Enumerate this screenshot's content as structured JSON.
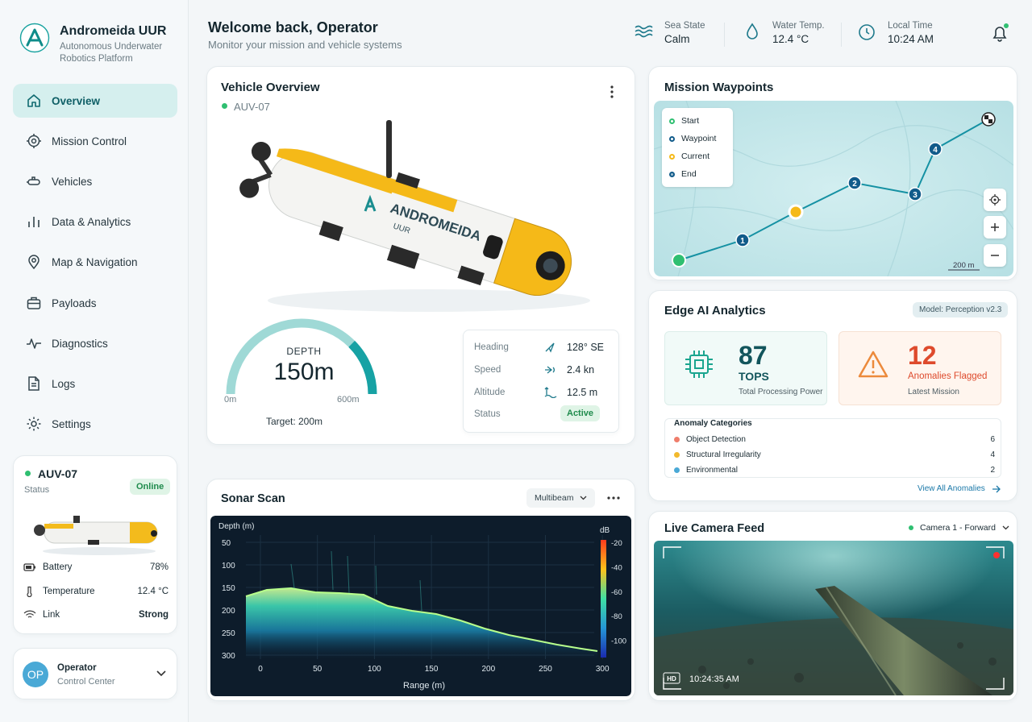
{
  "brand": {
    "name": "Andromeida UUR",
    "subtitle": "Autonomous Underwater Robotics Platform"
  },
  "nav": [
    {
      "label": "Overview",
      "icon": "home-icon"
    },
    {
      "label": "Mission Control",
      "icon": "target-icon"
    },
    {
      "label": "Vehicles",
      "icon": "submarine-icon"
    },
    {
      "label": "Data & Analytics",
      "icon": "bar-chart-icon"
    },
    {
      "label": "Map & Navigation",
      "icon": "map-pin-icon"
    },
    {
      "label": "Payloads",
      "icon": "briefcase-icon"
    },
    {
      "label": "Diagnostics",
      "icon": "pulse-icon"
    },
    {
      "label": "Logs",
      "icon": "document-icon"
    },
    {
      "label": "Settings",
      "icon": "gear-icon"
    }
  ],
  "vehicle_card": {
    "name": "AUV-07",
    "status_label": "Status",
    "status": "Online",
    "metrics": [
      {
        "label": "Battery",
        "value": "78%",
        "icon": "battery-icon"
      },
      {
        "label": "Temperature",
        "value": "12.4 °C",
        "icon": "thermometer-icon"
      },
      {
        "label": "Link",
        "value": "Strong",
        "icon": "wifi-icon"
      }
    ]
  },
  "user": {
    "initials": "OP",
    "name": "Operator",
    "role": "Control Center"
  },
  "header": {
    "title": "Welcome back, Operator",
    "subtitle": "Monitor your mission and vehicle systems"
  },
  "topstats": [
    {
      "label": "Sea State",
      "value": "Calm",
      "icon": "waves-icon"
    },
    {
      "label": "Water Temp.",
      "value": "12.4 °C",
      "icon": "droplet-icon"
    },
    {
      "label": "Local Time",
      "value": "10:24 AM",
      "icon": "clock-icon"
    }
  ],
  "overview": {
    "title": "Vehicle Overview",
    "vehicle": "AUV-07",
    "hull_text": "ANDROMEIDA",
    "hull_sub": "UUR",
    "depth": {
      "label": "DEPTH",
      "value": "150m",
      "min": "0m",
      "max": "600m",
      "target": "Target: 200m",
      "fraction": 0.25
    },
    "telemetry": [
      {
        "label": "Heading",
        "value": "128° SE"
      },
      {
        "label": "Speed",
        "value": "2.4 kn"
      },
      {
        "label": "Altitude",
        "value": "12.5 m"
      },
      {
        "label": "Status",
        "value": "Active"
      }
    ]
  },
  "waypoints": {
    "title": "Mission Waypoints",
    "legend": [
      "Start",
      "Waypoint",
      "Current",
      "End"
    ],
    "markers": [
      "1",
      "2",
      "3",
      "4"
    ],
    "scale": "200 m"
  },
  "ai": {
    "title": "Edge AI Analytics",
    "model": "Model: Perception v2.3",
    "tops": {
      "value": "87",
      "unit": "TOPS",
      "label": "Total Processing Power"
    },
    "anomalies": {
      "value": "12",
      "unit": "Anomalies Flagged",
      "label": "Latest Mission"
    },
    "cat_title": "Anomaly Categories",
    "categories": [
      {
        "name": "Object Detection",
        "count": "6",
        "color": "#ef7d6b"
      },
      {
        "name": "Structural Irregularity",
        "count": "4",
        "color": "#f2b92d"
      },
      {
        "name": "Environmental",
        "count": "2",
        "color": "#4aa9d6"
      }
    ],
    "link": "View All Anomalies"
  },
  "sonar": {
    "title": "Sonar Scan",
    "mode": "Multibeam",
    "ylabel": "Depth (m)",
    "xlabel": "Range (m)",
    "yticks": [
      "50",
      "100",
      "150",
      "200",
      "250",
      "300"
    ],
    "xticks": [
      "0",
      "50",
      "100",
      "150",
      "200",
      "250",
      "300"
    ],
    "db_label": "dB",
    "db_ticks": [
      "-20",
      "-40",
      "-60",
      "-80",
      "-100"
    ]
  },
  "camera": {
    "title": "Live Camera Feed",
    "source": "Camera 1 - Forward",
    "hd": "HD",
    "time": "10:24:35 AM"
  }
}
